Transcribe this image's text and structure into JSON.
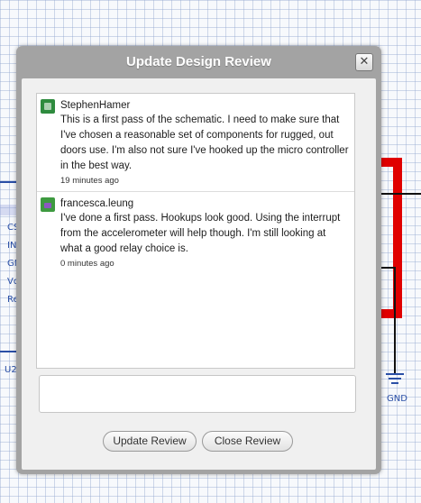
{
  "dialog": {
    "title": "Update Design Review",
    "close_symbol": "✕",
    "close_icon": "close-icon"
  },
  "comments": [
    {
      "author": "StephenHamer",
      "avatar_icon": "user-avatar-icon",
      "text": "This is a first pass of the schematic. I need to make sure that I've chosen a reasonable set of components for rugged, out doors use. I'm also not sure I've hooked up the micro controller in the best way.",
      "time": "19 minutes ago"
    },
    {
      "author": "francesca.leung",
      "avatar_icon": "user-avatar-icon",
      "text": "I've done a first pass. Hookups look good. Using the interrupt from the accelerometer will help though. I'm still looking at what a good relay choice is.",
      "time": "0 minutes ago"
    }
  ],
  "reply": {
    "value": "",
    "placeholder": ""
  },
  "buttons": {
    "update_label": "Update Review",
    "close_label": "Close Review"
  },
  "schematic": {
    "pins": [
      "CS",
      "INT",
      "GN",
      "Vd",
      "Re"
    ],
    "chip_name": "U2",
    "u_label": "U",
    "gnd_label": "GND"
  },
  "colors": {
    "dialog_frame": "#a3a3a3",
    "wire_red": "#e00000",
    "schematic_blue": "#2a4fa6"
  }
}
